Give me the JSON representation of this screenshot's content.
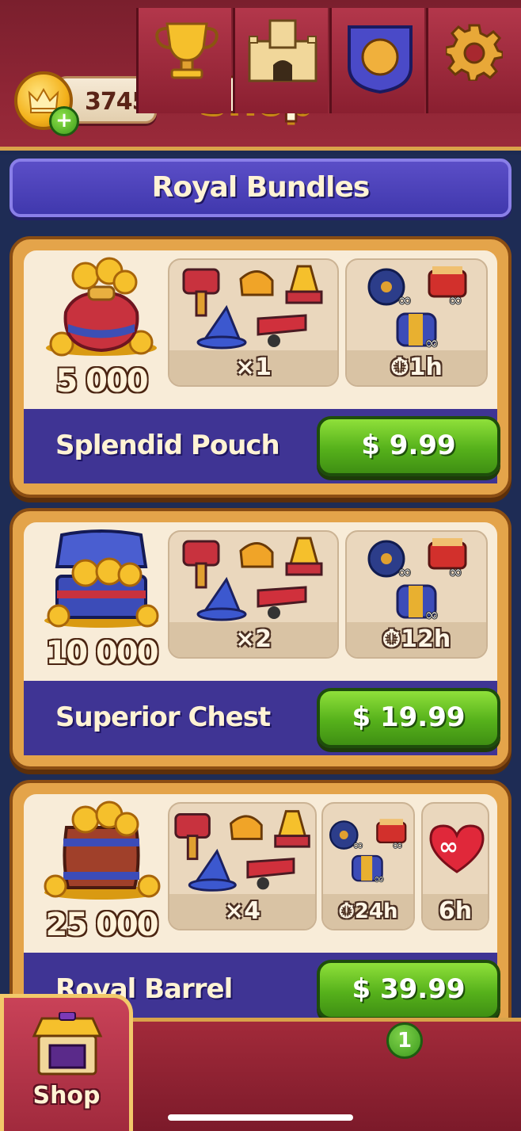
{
  "header": {
    "coins": "3745",
    "title": "Shop",
    "coin_icon": "crown-coin-icon",
    "plus_label": "+"
  },
  "banner": {
    "title": "Royal Bundles"
  },
  "bundles": [
    {
      "name": "Splendid Pouch",
      "coins": "5 000",
      "boosters_label": "×1",
      "unlimited_label": "1h",
      "price": "$ 9.99",
      "image": "coin-pouch-icon"
    },
    {
      "name": "Superior Chest",
      "coins": "10 000",
      "boosters_label": "×2",
      "unlimited_label": "12h",
      "price": "$ 19.99",
      "image": "treasure-chest-icon"
    },
    {
      "name": "Royal Barrel",
      "coins": "25 000",
      "boosters_label": "×4",
      "unlimited_label": "24h",
      "lives_label": "6h",
      "price": "$ 39.99",
      "image": "coin-barrel-icon"
    }
  ],
  "nav": {
    "shop_label": "Shop",
    "tabs": [
      "shop-icon",
      "trophy-icon",
      "castle-icon",
      "team-shield-icon",
      "settings-gear-icon"
    ],
    "team_badge": "1"
  },
  "colors": {
    "header_red": "#8e2535",
    "gold_border": "#e4a44a",
    "purple": "#3f3494",
    "buy_green": "#56b11b"
  }
}
